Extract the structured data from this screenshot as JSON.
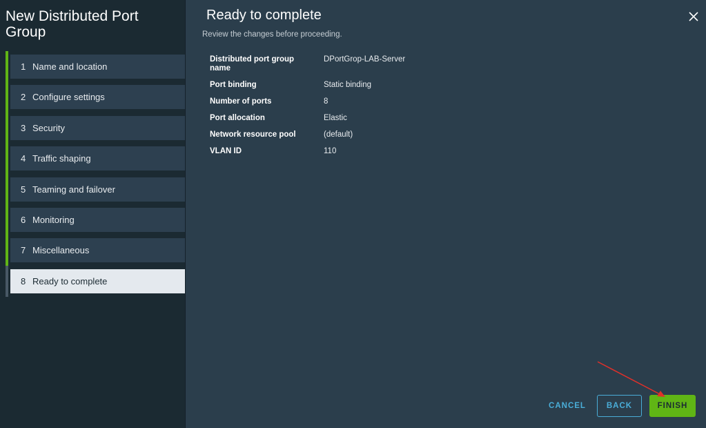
{
  "wizard": {
    "title": "New Distributed Port Group"
  },
  "steps": [
    {
      "num": "1",
      "label": "Name and location"
    },
    {
      "num": "2",
      "label": "Configure settings"
    },
    {
      "num": "3",
      "label": "Security"
    },
    {
      "num": "4",
      "label": "Traffic shaping"
    },
    {
      "num": "5",
      "label": "Teaming and failover"
    },
    {
      "num": "6",
      "label": "Monitoring"
    },
    {
      "num": "7",
      "label": "Miscellaneous"
    },
    {
      "num": "8",
      "label": "Ready to complete"
    }
  ],
  "page": {
    "title": "Ready to complete",
    "subtitle": "Review the changes before proceeding."
  },
  "review": [
    {
      "key": "Distributed port group name",
      "value": "DPortGrop-LAB-Server"
    },
    {
      "key": "Port binding",
      "value": "Static binding"
    },
    {
      "key": "Number of ports",
      "value": "8"
    },
    {
      "key": "Port allocation",
      "value": "Elastic"
    },
    {
      "key": "Network resource pool",
      "value": "(default)"
    },
    {
      "key": "VLAN ID",
      "value": "110"
    }
  ],
  "footer": {
    "cancel_label": "CANCEL",
    "back_label": "BACK",
    "finish_label": "FINISH"
  },
  "colors": {
    "accent_green": "#60b515",
    "link_blue": "#4aaed9",
    "annotation_arrow": "#e0302a"
  }
}
